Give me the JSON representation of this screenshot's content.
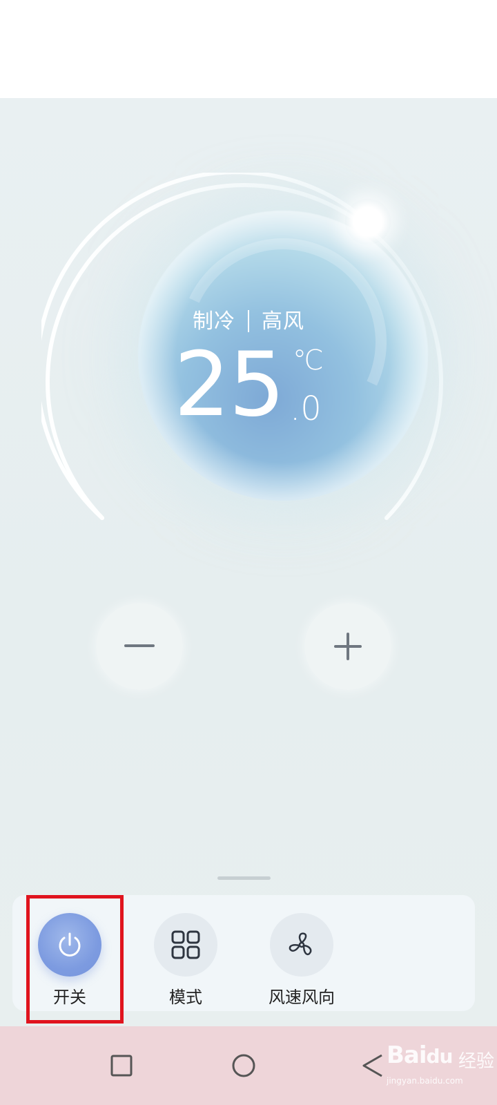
{
  "status": {
    "mode": "制冷",
    "fan_speed": "高风",
    "temperature_int": "25",
    "temperature_decimal": ".0",
    "unit": "℃"
  },
  "temp_controls": {
    "decrease_symbol": "—",
    "increase_symbol": "+"
  },
  "controls": [
    {
      "label": "开关",
      "icon": "power-icon",
      "active": true
    },
    {
      "label": "模式",
      "icon": "grid-icon",
      "active": false
    },
    {
      "label": "风速风向",
      "icon": "fan-icon",
      "active": false
    }
  ],
  "navbar": {
    "recent": "square-icon",
    "home": "circle-icon",
    "back": "triangle-back-icon"
  },
  "watermark": {
    "logo": "Bai经验",
    "brand_cn": "经验",
    "url": "jingyan.baidu.com"
  },
  "colors": {
    "power_active": "#7d9be0",
    "highlight": "#e0141e",
    "navbar_bg": "#eed5d9",
    "background": "#e8efef"
  }
}
